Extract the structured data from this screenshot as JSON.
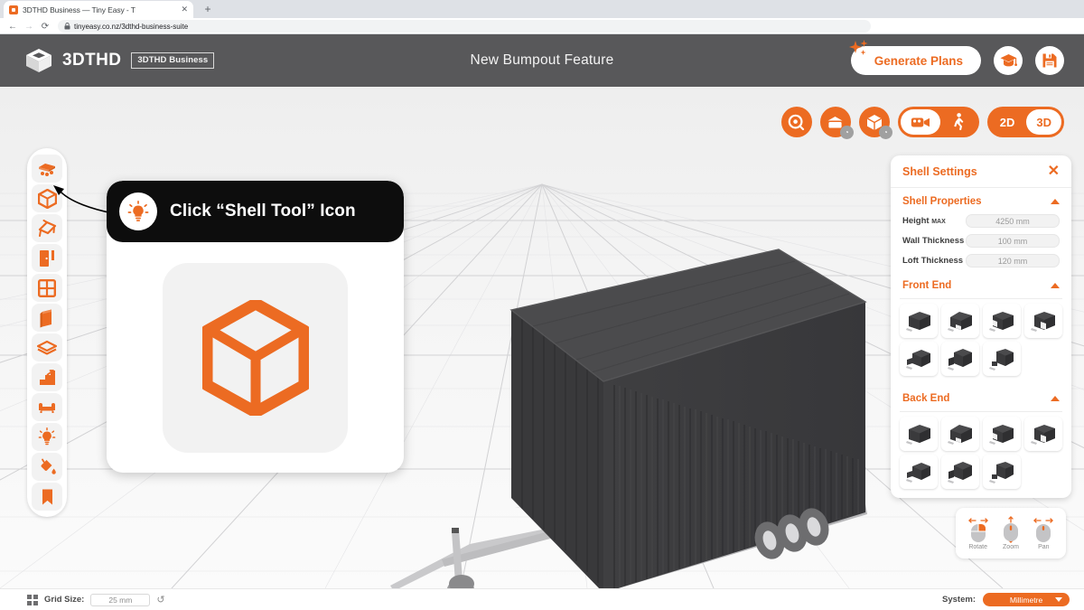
{
  "browser": {
    "tab_title": "3DTHD Business — Tiny Easy - T",
    "tab_close": "✕",
    "new_tab": "+",
    "back": "←",
    "forward": "→",
    "reload": "⟳",
    "lock_icon": "🔒",
    "url": "tinyeasy.co.nz/3dthd-business-suite",
    "toolbar_icons": [
      "zoom-icon",
      "share-icon",
      "bookmark-star-icon",
      "screenshot-icon",
      "globe-icon",
      "pencil-icon",
      "extensions-icon",
      "sidepanel-icon",
      "profile-icon",
      "menu-icon"
    ]
  },
  "header": {
    "logo_text": "3DTHD",
    "logo_badge": "3DTHD Business",
    "title": "New Bumpout Feature",
    "generate_button": "Generate Plans",
    "learn_button_icon": "graduation-cap-icon",
    "save_button_icon": "save-disk-icon"
  },
  "left_toolbar": {
    "items": [
      {
        "name": "chassis-tool",
        "label": "Chassis"
      },
      {
        "name": "shell-tool",
        "label": "Shell"
      },
      {
        "name": "roof-tool",
        "label": "Roof"
      },
      {
        "name": "door-tool",
        "label": "Door"
      },
      {
        "name": "window-tool",
        "label": "Window"
      },
      {
        "name": "wall-tool",
        "label": "Wall"
      },
      {
        "name": "floor-tool",
        "label": "Floor"
      },
      {
        "name": "stairs-tool",
        "label": "Stairs"
      },
      {
        "name": "furniture-tool",
        "label": "Furniture"
      },
      {
        "name": "lighting-tool",
        "label": "Lighting"
      },
      {
        "name": "paint-tool",
        "label": "Paint"
      },
      {
        "name": "bookmark-tool",
        "label": "Bookmark"
      }
    ]
  },
  "view_controls": {
    "measure_icon": "measure-tape-icon",
    "roof_toggle_icon": "roof-visibility-icon",
    "shell_toggle_icon": "shell-visibility-icon",
    "camera_label": "camera-icon",
    "walk_label": "walk-person-icon",
    "dim_2d": "2D",
    "dim_3d": "3D",
    "active_dim": "3D"
  },
  "panel": {
    "title": "Shell Settings",
    "close": "✕",
    "properties_section": {
      "title": "Shell Properties",
      "rows": [
        {
          "label": "Height",
          "sup": "MAX",
          "value": "4250 mm"
        },
        {
          "label": "Wall Thickness",
          "sup": "",
          "value": "100 mm"
        },
        {
          "label": "Loft Thickness",
          "sup": "",
          "value": "120 mm"
        }
      ]
    },
    "front_end": {
      "title": "Front End",
      "options": [
        "flat",
        "slant-left",
        "step-notch",
        "deep-notch",
        "low-step",
        "bump-out",
        "small-box"
      ]
    },
    "back_end": {
      "title": "Back End",
      "options": [
        "flat",
        "slant-left",
        "step-notch",
        "deep-notch",
        "low-step",
        "bump-out",
        "small-box"
      ]
    }
  },
  "callout": {
    "icon": "lightbulb-icon",
    "text": "Click “Shell Tool” Icon",
    "big_icon": "shell-cube-icon"
  },
  "mouse_hints": {
    "items": [
      {
        "label": "Rotate",
        "icon": "mouse-rotate-icon"
      },
      {
        "label": "Zoom",
        "icon": "mouse-zoom-icon"
      },
      {
        "label": "Pan",
        "icon": "mouse-pan-icon"
      }
    ]
  },
  "bottom_bar": {
    "grid_icon": "grid-icon",
    "grid_label": "Grid Size:",
    "grid_value": "25 mm",
    "reset_icon": "↺",
    "system_label": "System:",
    "system_value": "Millimetre"
  },
  "colors": {
    "accent": "#ec6b22",
    "header_bg": "#58585a",
    "panel_bg": "#ffffff",
    "model_dark": "#3a3a3c"
  }
}
